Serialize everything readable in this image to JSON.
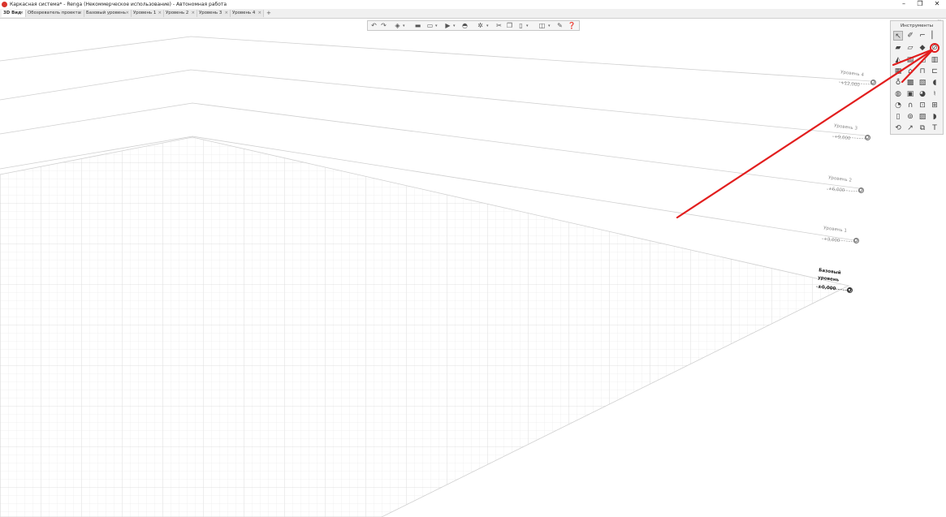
{
  "window": {
    "title": "Каркасная система* - Renga (Некоммерческое использование) - Автономная работа",
    "minimize_glyph": "–",
    "maximize_glyph": "❐",
    "close_glyph": "✕"
  },
  "tabs": [
    {
      "label": "3D Вид"
    },
    {
      "label": "Обозреватель проекта"
    },
    {
      "label": "Базовый уровень"
    },
    {
      "label": "Уровень 1"
    },
    {
      "label": "Уровень 2"
    },
    {
      "label": "Уровень 3"
    },
    {
      "label": "Уровень 4"
    }
  ],
  "tab_close_glyph": "×",
  "tab_add_glyph": "+",
  "collapse_glyph": "≫",
  "levels": [
    {
      "name": "Уровень 4",
      "elevation": "+12,000"
    },
    {
      "name": "Уровень 3",
      "elevation": "+9,000"
    },
    {
      "name": "Уровень 2",
      "elevation": "+6,000"
    },
    {
      "name": "Уровень 1",
      "elevation": "+3,000"
    },
    {
      "name_line1": "Базовый",
      "name_line2": "уровень",
      "elevation": "±0,000"
    }
  ],
  "toolbar": {
    "icons": [
      "undo-icon",
      "redo-icon",
      "view-cube-icon",
      "folder-icon",
      "save-icon",
      "export-icon",
      "print-icon",
      "settings-icon",
      "cut-icon",
      "copy-icon",
      "paste-icon",
      "layers-icon",
      "wrench-icon",
      "help-icon"
    ],
    "dropdown_glyph": "▾"
  },
  "tools_palette": {
    "title": "Инструменты",
    "tools": [
      "select",
      "drawing",
      "wall",
      "column",
      "beam",
      "brace",
      "plate",
      "level",
      "roof",
      "stair",
      "ramp",
      "railing",
      "opening",
      "door",
      "window",
      "room",
      "equipment",
      "pipe",
      "duct",
      "fixture",
      "floor",
      "slab",
      "foundation",
      "fence",
      "reinforcement",
      "line",
      "hatch",
      "dimension",
      "axis",
      "section",
      "tag",
      "text"
    ],
    "selected_tool": "select",
    "highlighted_tool": "level",
    "text_tool_glyph": "T"
  },
  "colors": {
    "annotation_red": "#e21e1e",
    "logo_red": "#d9342b"
  }
}
